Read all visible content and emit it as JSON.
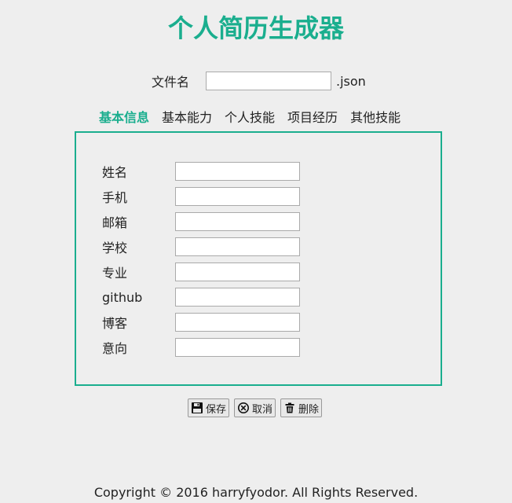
{
  "page": {
    "title": "个人简历生成器"
  },
  "filename": {
    "label": "文件名",
    "value": "",
    "extension": ".json"
  },
  "tabs": [
    {
      "label": "基本信息",
      "active": true
    },
    {
      "label": "基本能力",
      "active": false
    },
    {
      "label": "个人技能",
      "active": false
    },
    {
      "label": "项目经历",
      "active": false
    },
    {
      "label": "其他技能",
      "active": false
    }
  ],
  "form": {
    "fields": [
      {
        "label": "姓名",
        "value": ""
      },
      {
        "label": "手机",
        "value": ""
      },
      {
        "label": "邮箱",
        "value": ""
      },
      {
        "label": "学校",
        "value": ""
      },
      {
        "label": "专业",
        "value": ""
      },
      {
        "label": "github",
        "value": ""
      },
      {
        "label": "博客",
        "value": ""
      },
      {
        "label": "意向",
        "value": ""
      }
    ]
  },
  "actions": {
    "save": {
      "label": "保存",
      "icon": "floppy-disk-icon"
    },
    "cancel": {
      "label": "取消",
      "icon": "circle-x-icon"
    },
    "delete": {
      "label": "删除",
      "icon": "trash-icon"
    }
  },
  "footer": {
    "text": "Copyright © 2016 harryfyodor. All Rights Reserved."
  },
  "colors": {
    "accent": "#1aae8e",
    "background": "#eeeeee"
  }
}
